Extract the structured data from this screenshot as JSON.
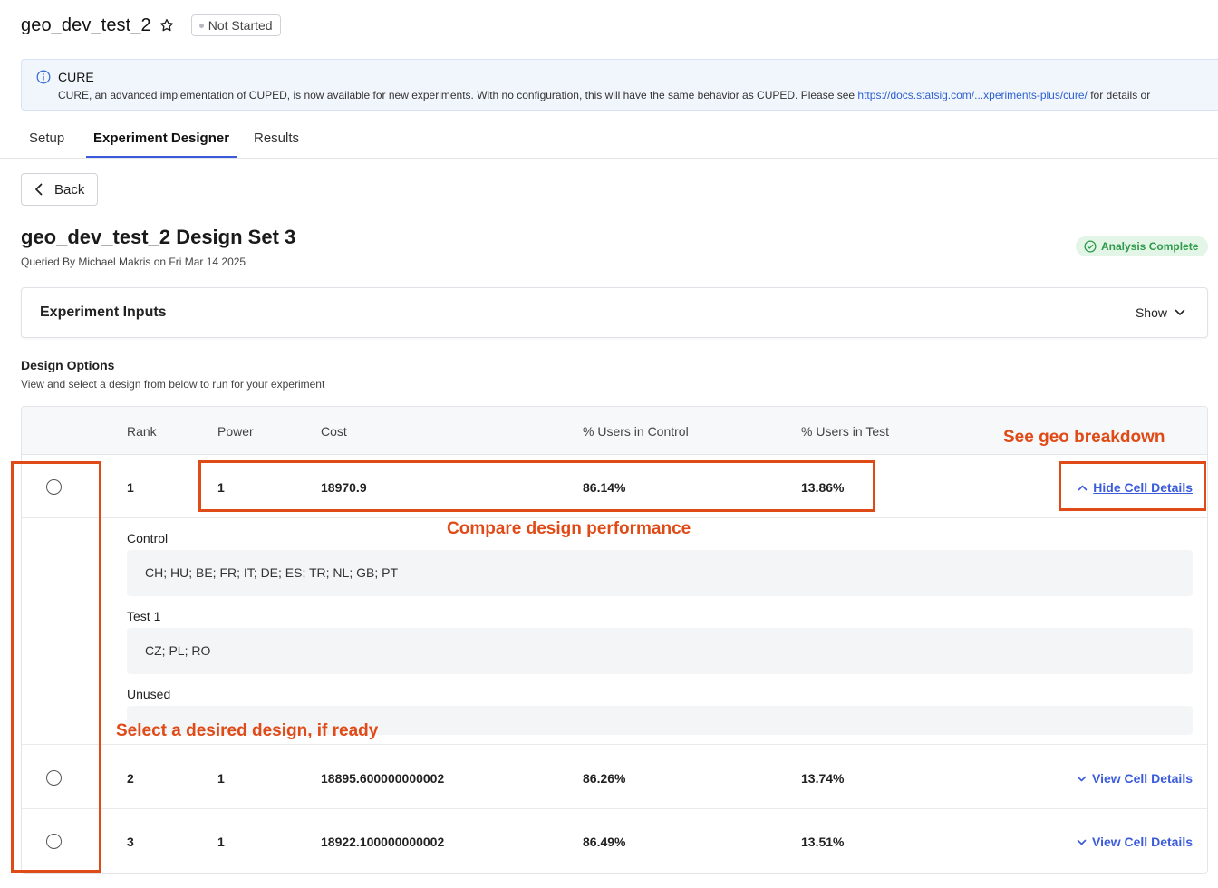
{
  "header": {
    "title": "geo_dev_test_2",
    "status": "Not Started"
  },
  "banner": {
    "title": "CURE",
    "text_before": "CURE, an advanced implementation of CUPED, is now available for new experiments. With no configuration, this will have the same behavior as CUPED. Please see ",
    "link": "https://docs.statsig.com/...xperiments-plus/cure/",
    "text_after": " for details or"
  },
  "tabs": [
    "Setup",
    "Experiment Designer",
    "Results"
  ],
  "back_label": "Back",
  "design": {
    "title": "geo_dev_test_2 Design Set 3",
    "queried": "Queried By Michael Makris on Fri Mar 14 2025",
    "badge": "Analysis Complete"
  },
  "inputs": {
    "title": "Experiment Inputs",
    "toggle": "Show"
  },
  "options": {
    "title": "Design Options",
    "subtitle": "View and select a design from below to run for your experiment"
  },
  "table": {
    "headers": [
      "Rank",
      "Power",
      "Cost",
      "% Users in Control",
      "% Users in Test"
    ],
    "rows": [
      {
        "rank": "1",
        "power": "1",
        "cost": "18970.9",
        "control": "86.14%",
        "test": "13.86%",
        "link": "Hide Cell Details"
      },
      {
        "rank": "2",
        "power": "1",
        "cost": "18895.600000000002",
        "control": "86.26%",
        "test": "13.74%",
        "link": "View Cell Details"
      },
      {
        "rank": "3",
        "power": "1",
        "cost": "18922.100000000002",
        "control": "86.49%",
        "test": "13.51%",
        "link": "View Cell Details"
      }
    ],
    "details": {
      "control_label": "Control",
      "control_value": "CH; HU; BE; FR; IT; DE; ES; TR; NL; GB; PT",
      "test_label": "Test 1",
      "test_value": "CZ; PL; RO",
      "unused_label": "Unused"
    }
  },
  "annotations": {
    "geo": "See geo breakdown",
    "compare": "Compare design performance",
    "select": "Select a desired design, if ready",
    "color": "#e04a16"
  }
}
